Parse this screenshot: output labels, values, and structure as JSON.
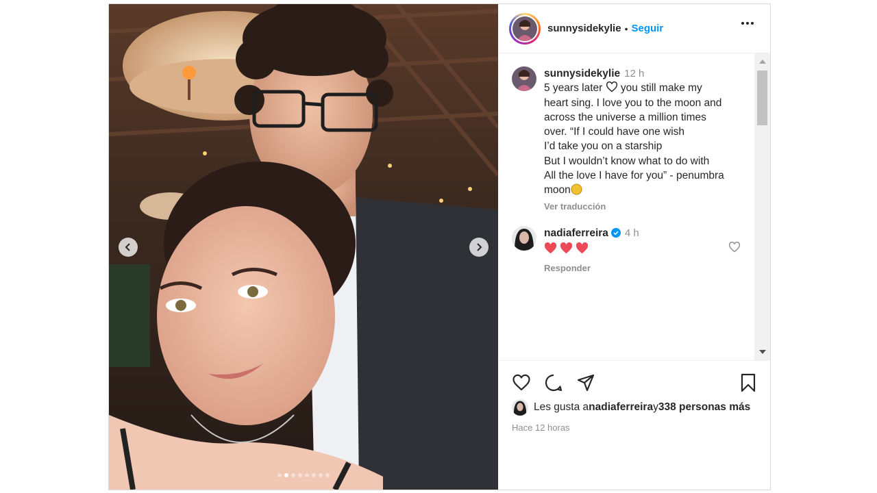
{
  "post": {
    "author": "sunnysidekylie",
    "separator": "•",
    "follow_label": "Seguir",
    "more_label": "More options"
  },
  "carousel": {
    "total_slides": 8,
    "active_slide": 1
  },
  "caption": {
    "username": "sunnysidekylie",
    "time": "12 h",
    "lines": [
      "5 years later ",
      " you still make my",
      "heart sing. I love you to the moon and",
      "across the universe a million times",
      "over. “If I could have one wish",
      "I’d take you on a starship",
      "But I wouldn’t know what to do with",
      "All the love I have for you” - penumbra",
      "moon"
    ],
    "translate_label": "Ver traducción"
  },
  "comment": {
    "username": "nadiaferreira",
    "time": "4 h",
    "reply_label": "Responder",
    "emoji_count": 3
  },
  "likes": {
    "prefix": "Les gusta a ",
    "user": "nadiaferreira",
    "middle": " y ",
    "others": "338 personas más"
  },
  "timestamp": "Hace 12 horas",
  "colors": {
    "accent": "#0095f6",
    "text": "#262626",
    "muted": "#8e8e8e",
    "heart": "#ed4956",
    "verified": "#0095f6"
  }
}
